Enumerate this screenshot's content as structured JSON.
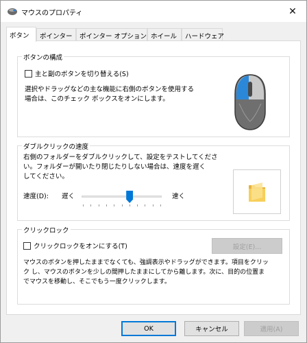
{
  "window": {
    "title": "マウスのプロパティ",
    "close_glyph": "✕"
  },
  "tabs": [
    {
      "label": "ボタン",
      "active": true
    },
    {
      "label": "ポインター",
      "active": false
    },
    {
      "label": "ポインター オプション",
      "active": false
    },
    {
      "label": "ホイール",
      "active": false
    },
    {
      "label": "ハードウェア",
      "active": false
    }
  ],
  "button_config": {
    "title": "ボタンの構成",
    "checkbox_label": "主と副のボタンを切り替える(S)",
    "checkbox_checked": false,
    "description_line1": "選択やドラッグなどの主な機能に右側のボタンを使用する",
    "description_line2": "場合は、このチェック ボックスをオンにします。"
  },
  "double_click": {
    "title": "ダブルクリックの速度",
    "description_line1": "右側のフォルダーをダブルクリックして、設定をテストしてくださ",
    "description_line2": "い。フォルダーが開いたり閉じたりしない場合は、速度を遅く",
    "description_line3": "してください。",
    "speed_label": "速度(D):",
    "slow_label": "遅く",
    "fast_label": "速く",
    "speed_value": 0.6,
    "tick_count": 11
  },
  "click_lock": {
    "title": "クリックロック",
    "checkbox_label": "クリックロックをオンにする(T)",
    "checkbox_checked": false,
    "settings_button": "設定(E)...",
    "description_line1": "マウスのボタンを押したままでなくても、強調表示やドラッグができます。項目をクリッ",
    "description_line2": "ク し、マウスのボタンを少しの間押したままにしてから離します。次に、目的の位置ま",
    "description_line3": "でマウスを移動し、そこでもう一度クリックします。"
  },
  "footer": {
    "ok": "OK",
    "cancel": "キャンセル",
    "apply": "適用(A)"
  },
  "colors": {
    "accent": "#0078d7",
    "mouse_body": "#7a7a7a",
    "folder": "#f5c64a"
  },
  "icons": {
    "title": "mouse-icon",
    "mouse_illustration": "mouse-left-button-highlighted",
    "folder": "folder-icon"
  }
}
